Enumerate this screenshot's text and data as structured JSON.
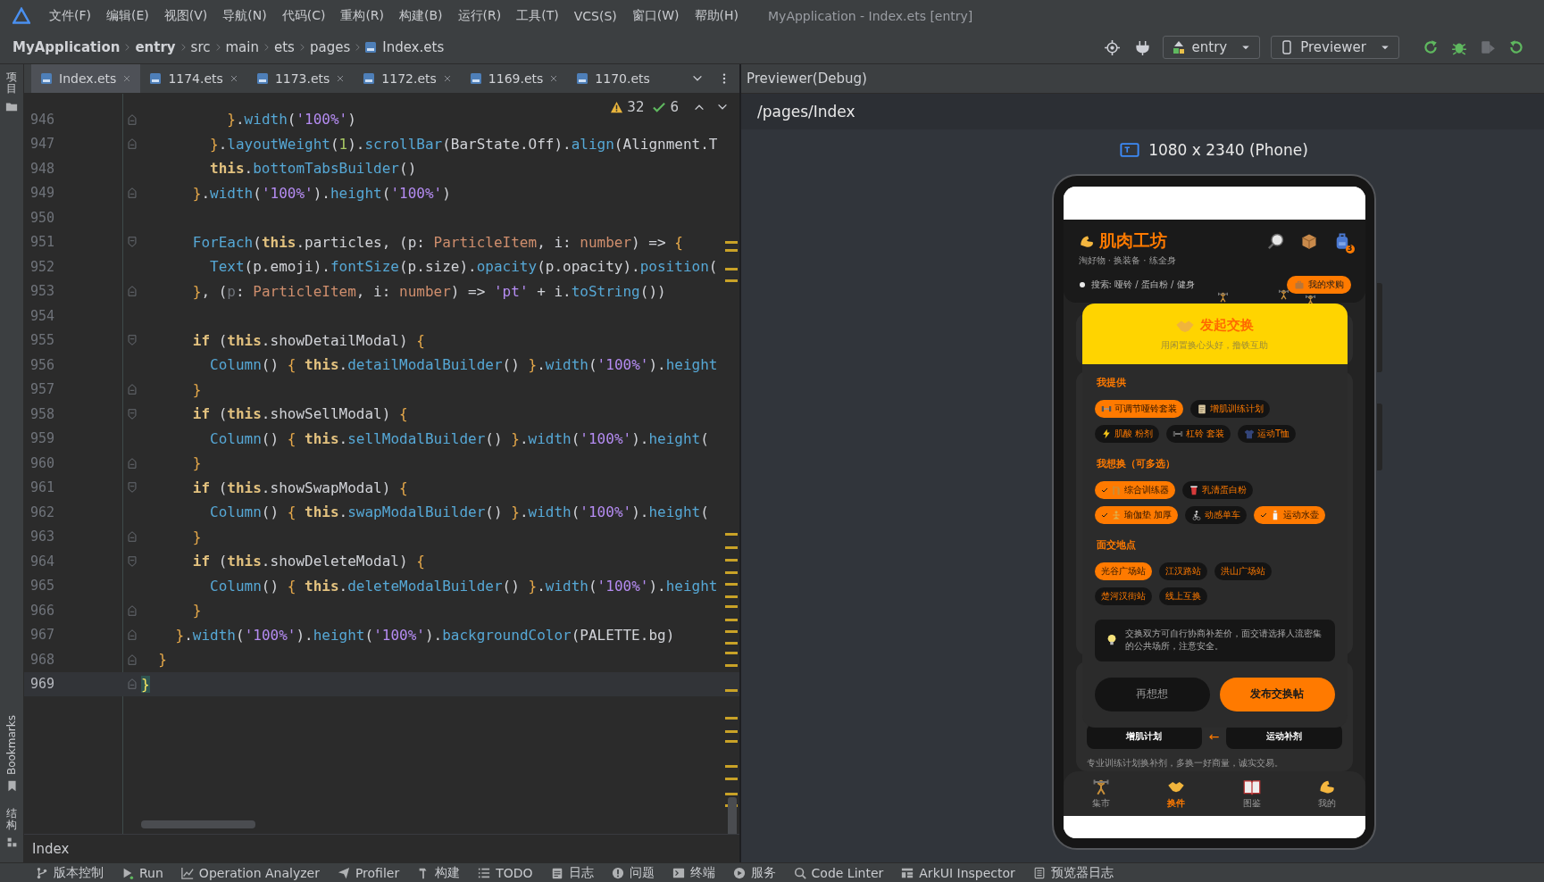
{
  "menu": {
    "items": [
      "文件(F)",
      "编辑(E)",
      "视图(V)",
      "导航(N)",
      "代码(C)",
      "重构(R)",
      "构建(B)",
      "运行(R)",
      "工具(T)",
      "VCS(S)",
      "窗口(W)",
      "帮助(H)"
    ],
    "title": "MyApplication - Index.ets [entry]"
  },
  "navigation": {
    "breadcrumb": [
      "MyApplication",
      "entry",
      "src",
      "main",
      "ets",
      "pages",
      "Index.ets"
    ],
    "module": "entry",
    "device": "Previewer"
  },
  "side_stripe": {
    "project": "项目",
    "bookmarks": "Bookmarks",
    "structure": "结构"
  },
  "editor": {
    "tabs": [
      {
        "label": "Index.ets",
        "selected": true,
        "closable": true
      },
      {
        "label": "1174.ets",
        "selected": false,
        "closable": true
      },
      {
        "label": "1173.ets",
        "selected": false,
        "closable": true
      },
      {
        "label": "1172.ets",
        "selected": false,
        "closable": true
      },
      {
        "label": "1169.ets",
        "selected": false,
        "closable": true
      },
      {
        "label": "1170.ets",
        "selected": false,
        "closable": false
      }
    ],
    "inspections": {
      "warnings": "32",
      "passed": "6"
    },
    "lines": [
      {
        "number": "946",
        "current": false,
        "kind": "closer",
        "code": [
          {
            "text": "          }",
            "kind": "brace"
          },
          {
            "text": ".",
            "kind": "plain"
          },
          {
            "text": "width",
            "kind": "method"
          },
          {
            "text": "(",
            "kind": "plain"
          },
          {
            "text": "'100%'",
            "kind": "string"
          },
          {
            "text": ")",
            "kind": "plain"
          }
        ]
      },
      {
        "number": "947",
        "current": false,
        "kind": "closer",
        "code": [
          {
            "text": "        }",
            "kind": "brace"
          },
          {
            "text": ".",
            "kind": "plain"
          },
          {
            "text": "layoutWeight",
            "kind": "method"
          },
          {
            "text": "(",
            "kind": "plain"
          },
          {
            "text": "1",
            "kind": "number"
          },
          {
            "text": ").",
            "kind": "plain"
          },
          {
            "text": "scrollBar",
            "kind": "method"
          },
          {
            "text": "(BarState.Off).",
            "kind": "plain"
          },
          {
            "text": "align",
            "kind": "method"
          },
          {
            "text": "(Alignment.T",
            "kind": "plain"
          }
        ]
      },
      {
        "number": "948",
        "current": false,
        "kind": "plain",
        "code": [
          {
            "text": "        this",
            "kind": "keyword"
          },
          {
            "text": ".",
            "kind": "plain"
          },
          {
            "text": "bottomTabsBuilder",
            "kind": "method"
          },
          {
            "text": "()",
            "kind": "plain"
          }
        ]
      },
      {
        "number": "949",
        "current": false,
        "kind": "closer",
        "code": [
          {
            "text": "      }",
            "kind": "brace"
          },
          {
            "text": ".",
            "kind": "plain"
          },
          {
            "text": "width",
            "kind": "method"
          },
          {
            "text": "(",
            "kind": "plain"
          },
          {
            "text": "'100%'",
            "kind": "string"
          },
          {
            "text": ").",
            "kind": "plain"
          },
          {
            "text": "height",
            "kind": "method"
          },
          {
            "text": "(",
            "kind": "plain"
          },
          {
            "text": "'100%'",
            "kind": "string"
          },
          {
            "text": ")",
            "kind": "plain"
          }
        ]
      },
      {
        "number": "950",
        "current": false,
        "kind": "plain"
      },
      {
        "number": "951",
        "current": false,
        "kind": "opener",
        "code": [
          {
            "text": "      ForEach",
            "kind": "method"
          },
          {
            "text": "(",
            "kind": "plain"
          },
          {
            "text": "this",
            "kind": "keyword"
          },
          {
            "text": ".particles, (p: ",
            "kind": "plain"
          },
          {
            "text": "ParticleItem",
            "kind": "type"
          },
          {
            "text": ", i: ",
            "kind": "plain"
          },
          {
            "text": "number",
            "kind": "type"
          },
          {
            "text": ") => ",
            "kind": "plain"
          },
          {
            "text": "{",
            "kind": "brace"
          }
        ]
      },
      {
        "number": "952",
        "current": false,
        "kind": "plain",
        "code": [
          {
            "text": "        Text",
            "kind": "method"
          },
          {
            "text": "(p.emoji).",
            "kind": "plain"
          },
          {
            "text": "fontSize",
            "kind": "method"
          },
          {
            "text": "(p.size).",
            "kind": "plain"
          },
          {
            "text": "opacity",
            "kind": "method"
          },
          {
            "text": "(p.opacity).",
            "kind": "plain"
          },
          {
            "text": "position",
            "kind": "method"
          },
          {
            "text": "(",
            "kind": "plain"
          }
        ]
      },
      {
        "number": "953",
        "current": false,
        "kind": "closer",
        "code": [
          {
            "text": "      }",
            "kind": "brace"
          },
          {
            "text": ", (",
            "kind": "plain"
          },
          {
            "text": "p",
            "kind": "unused"
          },
          {
            "text": ": ",
            "kind": "plain"
          },
          {
            "text": "ParticleItem",
            "kind": "type"
          },
          {
            "text": ", i: ",
            "kind": "plain"
          },
          {
            "text": "number",
            "kind": "type"
          },
          {
            "text": ") => ",
            "kind": "plain"
          },
          {
            "text": "'pt'",
            "kind": "string"
          },
          {
            "text": " + i.",
            "kind": "plain"
          },
          {
            "text": "toString",
            "kind": "method"
          },
          {
            "text": "())",
            "kind": "plain"
          }
        ]
      },
      {
        "number": "954",
        "current": false,
        "kind": "plain"
      },
      {
        "number": "955",
        "current": false,
        "kind": "opener",
        "code": [
          {
            "text": "      if",
            "kind": "keyword"
          },
          {
            "text": " (",
            "kind": "plain"
          },
          {
            "text": "this",
            "kind": "keyword"
          },
          {
            "text": ".showDetailModal) ",
            "kind": "plain"
          },
          {
            "text": "{",
            "kind": "brace"
          }
        ]
      },
      {
        "number": "956",
        "current": false,
        "kind": "plain",
        "code": [
          {
            "text": "        Column",
            "kind": "method"
          },
          {
            "text": "() ",
            "kind": "plain"
          },
          {
            "text": "{",
            "kind": "brace"
          },
          {
            "text": " this",
            "kind": "keyword"
          },
          {
            "text": ".",
            "kind": "plain"
          },
          {
            "text": "detailModalBuilder",
            "kind": "method"
          },
          {
            "text": "() ",
            "kind": "plain"
          },
          {
            "text": "}",
            "kind": "brace"
          },
          {
            "text": ".",
            "kind": "plain"
          },
          {
            "text": "width",
            "kind": "method"
          },
          {
            "text": "(",
            "kind": "plain"
          },
          {
            "text": "'100%'",
            "kind": "string"
          },
          {
            "text": ").",
            "kind": "plain"
          },
          {
            "text": "height",
            "kind": "method"
          }
        ]
      },
      {
        "number": "957",
        "current": false,
        "kind": "closer",
        "code": [
          {
            "text": "      }",
            "kind": "brace"
          }
        ]
      },
      {
        "number": "958",
        "current": false,
        "kind": "opener",
        "code": [
          {
            "text": "      if",
            "kind": "keyword"
          },
          {
            "text": " (",
            "kind": "plain"
          },
          {
            "text": "this",
            "kind": "keyword"
          },
          {
            "text": ".showSellModal) ",
            "kind": "plain"
          },
          {
            "text": "{",
            "kind": "brace"
          }
        ]
      },
      {
        "number": "959",
        "current": false,
        "kind": "plain",
        "code": [
          {
            "text": "        Column",
            "kind": "method"
          },
          {
            "text": "() ",
            "kind": "plain"
          },
          {
            "text": "{",
            "kind": "brace"
          },
          {
            "text": " this",
            "kind": "keyword"
          },
          {
            "text": ".",
            "kind": "plain"
          },
          {
            "text": "sellModalBuilder",
            "kind": "method"
          },
          {
            "text": "() ",
            "kind": "plain"
          },
          {
            "text": "}",
            "kind": "brace"
          },
          {
            "text": ".",
            "kind": "plain"
          },
          {
            "text": "width",
            "kind": "method"
          },
          {
            "text": "(",
            "kind": "plain"
          },
          {
            "text": "'100%'",
            "kind": "string"
          },
          {
            "text": ").",
            "kind": "plain"
          },
          {
            "text": "height",
            "kind": "method"
          },
          {
            "text": "(",
            "kind": "plain"
          }
        ]
      },
      {
        "number": "960",
        "current": false,
        "kind": "closer",
        "code": [
          {
            "text": "      }",
            "kind": "brace"
          }
        ]
      },
      {
        "number": "961",
        "current": false,
        "kind": "opener",
        "code": [
          {
            "text": "      if",
            "kind": "keyword"
          },
          {
            "text": " (",
            "kind": "plain"
          },
          {
            "text": "this",
            "kind": "keyword"
          },
          {
            "text": ".showSwapModal) ",
            "kind": "plain"
          },
          {
            "text": "{",
            "kind": "brace"
          }
        ]
      },
      {
        "number": "962",
        "current": false,
        "kind": "plain",
        "code": [
          {
            "text": "        Column",
            "kind": "method"
          },
          {
            "text": "() ",
            "kind": "plain"
          },
          {
            "text": "{",
            "kind": "brace"
          },
          {
            "text": " this",
            "kind": "keyword"
          },
          {
            "text": ".",
            "kind": "plain"
          },
          {
            "text": "swapModalBuilder",
            "kind": "method"
          },
          {
            "text": "() ",
            "kind": "plain"
          },
          {
            "text": "}",
            "kind": "brace"
          },
          {
            "text": ".",
            "kind": "plain"
          },
          {
            "text": "width",
            "kind": "method"
          },
          {
            "text": "(",
            "kind": "plain"
          },
          {
            "text": "'100%'",
            "kind": "string"
          },
          {
            "text": ").",
            "kind": "plain"
          },
          {
            "text": "height",
            "kind": "method"
          },
          {
            "text": "(",
            "kind": "plain"
          }
        ]
      },
      {
        "number": "963",
        "current": false,
        "kind": "closer",
        "code": [
          {
            "text": "      }",
            "kind": "brace"
          }
        ]
      },
      {
        "number": "964",
        "current": false,
        "kind": "opener",
        "code": [
          {
            "text": "      if",
            "kind": "keyword"
          },
          {
            "text": " (",
            "kind": "plain"
          },
          {
            "text": "this",
            "kind": "keyword"
          },
          {
            "text": ".showDeleteModal) ",
            "kind": "plain"
          },
          {
            "text": "{",
            "kind": "brace"
          }
        ]
      },
      {
        "number": "965",
        "current": false,
        "kind": "plain",
        "code": [
          {
            "text": "        Column",
            "kind": "method"
          },
          {
            "text": "() ",
            "kind": "plain"
          },
          {
            "text": "{",
            "kind": "brace"
          },
          {
            "text": " this",
            "kind": "keyword"
          },
          {
            "text": ".",
            "kind": "plain"
          },
          {
            "text": "deleteModalBuilder",
            "kind": "method"
          },
          {
            "text": "() ",
            "kind": "plain"
          },
          {
            "text": "}",
            "kind": "brace"
          },
          {
            "text": ".",
            "kind": "plain"
          },
          {
            "text": "width",
            "kind": "method"
          },
          {
            "text": "(",
            "kind": "plain"
          },
          {
            "text": "'100%'",
            "kind": "string"
          },
          {
            "text": ").",
            "kind": "plain"
          },
          {
            "text": "height",
            "kind": "method"
          }
        ]
      },
      {
        "number": "966",
        "current": false,
        "kind": "closer",
        "code": [
          {
            "text": "      }",
            "kind": "brace"
          }
        ]
      },
      {
        "number": "967",
        "current": false,
        "kind": "closer",
        "code": [
          {
            "text": "    }",
            "kind": "brace"
          },
          {
            "text": ".",
            "kind": "plain"
          },
          {
            "text": "width",
            "kind": "method"
          },
          {
            "text": "(",
            "kind": "plain"
          },
          {
            "text": "'100%'",
            "kind": "string"
          },
          {
            "text": ").",
            "kind": "plain"
          },
          {
            "text": "height",
            "kind": "method"
          },
          {
            "text": "(",
            "kind": "plain"
          },
          {
            "text": "'100%'",
            "kind": "string"
          },
          {
            "text": ").",
            "kind": "plain"
          },
          {
            "text": "backgroundColor",
            "kind": "method"
          },
          {
            "text": "(PALETTE.bg)",
            "kind": "plain"
          }
        ]
      },
      {
        "number": "968",
        "current": false,
        "kind": "closer",
        "code": [
          {
            "text": "  }",
            "kind": "brace"
          }
        ]
      },
      {
        "number": "969",
        "current": true,
        "kind": "closer",
        "code": [
          {
            "text": "}",
            "kind": "match"
          }
        ]
      }
    ],
    "footer": "Index"
  },
  "previewer": {
    "title": "Previewer(Debug)",
    "path": "/pages/Index",
    "device": "1080 x 2340 (Phone)",
    "app": {
      "title": "肌肉工坊",
      "subtitle": "淘好物 · 换装备 · 练全身",
      "bag_badge": "3",
      "search": {
        "placeholder": "搜索: 哑铃 / 蛋白粉 / 健身"
      },
      "wanted_button": "我的求购",
      "listing": {
        "from": "增肌计划",
        "arrow": "←",
        "to": "运动补剂",
        "note": "专业训练计划换补剂，多换一好商量，诚实交易。"
      },
      "modal": {
        "title": "发起交换",
        "subtitle": "用闲置换心头好，撸铁互助",
        "sections": [
          {
            "kind": "offer",
            "heading": "我提供",
            "chips": [
              {
                "label": "可调节哑铃套装",
                "selected": true
              },
              {
                "label": "增肌训练计划",
                "selected": false
              },
              {
                "label": "肌酸 粉剂",
                "selected": false
              },
              {
                "label": "杠铃 套装",
                "selected": false
              },
              {
                "label": "运动T恤",
                "selected": false
              }
            ]
          },
          {
            "kind": "want",
            "heading": "我想换（可多选）",
            "chips": [
              {
                "label": "综合训练器",
                "selected": true
              },
              {
                "label": "乳清蛋白粉",
                "selected": false
              },
              {
                "label": "瑜伽垫 加厚",
                "selected": true
              },
              {
                "label": "动感单车",
                "selected": false
              },
              {
                "label": "运动水壶",
                "selected": true
              }
            ]
          },
          {
            "kind": "place",
            "heading": "面交地点",
            "chips": [
              {
                "label": "光谷广场站",
                "selected": true
              },
              {
                "label": "江汉路站",
                "selected": false
              },
              {
                "label": "洪山广场站",
                "selected": false
              },
              {
                "label": "楚河汉街站",
                "selected": false
              },
              {
                "label": "线上互换",
                "selected": false
              }
            ]
          }
        ],
        "tip": "交换双方可自行协商补差价，面交请选择人流密集的公共场所，注意安全。",
        "buttons": [
          {
            "label": "再想想",
            "kind": "secondary"
          },
          {
            "label": "发布交换帖",
            "kind": "primary"
          }
        ]
      },
      "tabs": [
        {
          "label": "集市",
          "selected": false
        },
        {
          "label": "换件",
          "selected": true
        },
        {
          "label": "图鉴",
          "selected": false
        },
        {
          "label": "我的",
          "selected": false
        }
      ]
    }
  },
  "tool_windows": [
    "版本控制",
    "Run",
    "Operation Analyzer",
    "Profiler",
    "构建",
    "TODO",
    "日志",
    "问题",
    "终端",
    "服务",
    "Code Linter",
    "ArkUI Inspector",
    "预览器日志"
  ]
}
